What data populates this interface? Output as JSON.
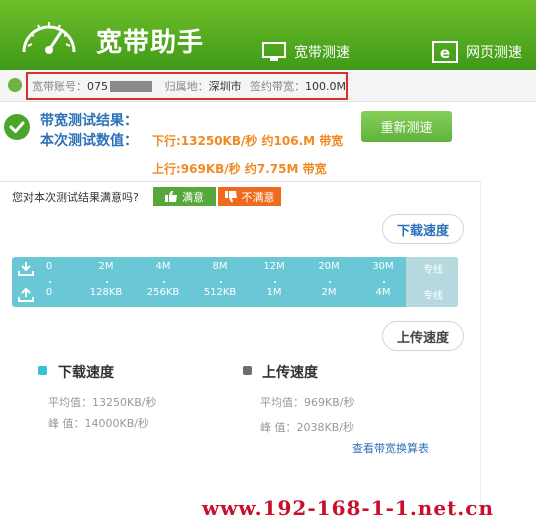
{
  "app": {
    "title": "宽带助手"
  },
  "nav": {
    "bandwidth": "宽带测速",
    "web": "网页测速"
  },
  "account": {
    "account_label": "宽带账号：",
    "account_value": "075",
    "region_label": "归属地：",
    "region_value": "深圳市",
    "bandwidth_label": "签约带宽：",
    "bandwidth_value": "100.0M"
  },
  "result": {
    "title": "带宽测试结果：",
    "sub": "本次测试数值：",
    "download": "下行:13250KB/秒 约106.M 带宽",
    "upload": "上行:969KB/秒 约7.75M 带宽",
    "retest": "重新测速"
  },
  "feedback": {
    "question": "您对本次测试结果满意吗?",
    "satisfied": "满意",
    "unsatisfied": "不满意"
  },
  "tabs": {
    "download": "下载速度",
    "upload": "上传速度"
  },
  "scale": {
    "top": [
      "0",
      "2M",
      "4M",
      "8M",
      "12M",
      "20M",
      "30M",
      "专线"
    ],
    "bottom": [
      "0",
      "128KB",
      "256KB",
      "512KB",
      "1M",
      "2M",
      "4M",
      "专线"
    ]
  },
  "legend": {
    "download": {
      "label": "下载速度",
      "avg": "平均值：13250KB/秒",
      "peak": "峰 值：14000KB/秒",
      "color": "#33c2d3"
    },
    "upload": {
      "label": "上传速度",
      "avg": "平均值：969KB/秒",
      "peak": "峰 值：2038KB/秒",
      "color": "#6d6d6d"
    }
  },
  "link": "查看带宽换算表",
  "watermark": "www.192-168-1-1.net.cn",
  "colors": {
    "brand_green": "#4aa52c",
    "accent_orange": "#f08a24",
    "link_blue": "#2d72b8",
    "alert_red": "#d9302a"
  }
}
